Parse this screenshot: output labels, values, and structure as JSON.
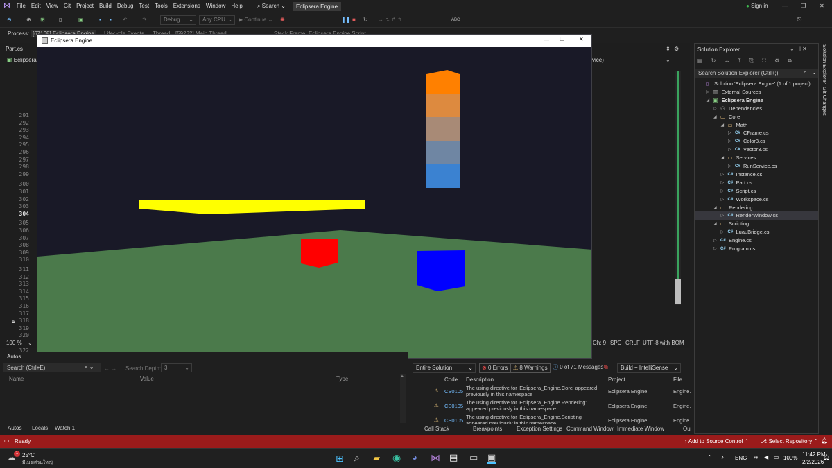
{
  "menubar": {
    "items": [
      "File",
      "Edit",
      "View",
      "Git",
      "Project",
      "Build",
      "Debug",
      "Test",
      "Tools",
      "Extensions",
      "Window",
      "Help"
    ],
    "search_label": "Search",
    "solution_title": "Eclipsera Engine",
    "sign_in": "Sign in"
  },
  "toolbar": {
    "config": "Debug",
    "platform": "Any CPU",
    "continue_label": "Continue"
  },
  "debugbar": {
    "process_label": "Process:",
    "process_value": "[67168] Eclipsera.Engine",
    "lifecycle": "Lifecycle Events",
    "thread_label": "Thread:",
    "thread_value": "[59232] Main Thread",
    "stack_frame": "Stack Frame:",
    "stack_value": "Eclipsera.Engine.Script"
  },
  "editor": {
    "file_tab": "Part.cs",
    "project_dropdown": "Eclipsera",
    "member_dropdown": "vice)",
    "line_numbers": [
      "291",
      "292",
      "293",
      "294",
      "295",
      "296",
      "297",
      "298",
      "299",
      "300",
      "301",
      "302",
      "303",
      "304",
      "305",
      "306",
      "307",
      "308",
      "309",
      "310",
      "311",
      "312",
      "313",
      "314",
      "315",
      "316",
      "317",
      "318",
      "319",
      "320",
      "321",
      "322"
    ],
    "zoom": "100 %",
    "ch": "Ch: 9",
    "spc": "SPC",
    "crlf": "CRLF",
    "encoding": "UTF-8 with BOM"
  },
  "render_window": {
    "title": "Eclipsera Engine",
    "colors": {
      "background": "#191927",
      "ground": "#4b7a4b",
      "beam": "#ffff00",
      "red_cube": "#ff0000",
      "blue_cube": "#0000ff",
      "stack": [
        "#ff8000",
        "#dd8a3f",
        "#a88a76",
        "#6f86a3",
        "#3b82d1"
      ]
    }
  },
  "solution_explorer": {
    "title": "Solution Explorer",
    "search_placeholder": "Search Solution Explorer (Ctrl+;)",
    "side_tabs": [
      "Solution Explorer",
      "Git Changes"
    ],
    "tree": [
      {
        "label": "Solution 'Eclipsera Engine' (1 of 1 project)",
        "depth": 0,
        "kind": "solution"
      },
      {
        "label": "External Sources",
        "depth": 1,
        "kind": "ext"
      },
      {
        "label": "Eclipsera Engine",
        "depth": 1,
        "kind": "project"
      },
      {
        "label": "Dependencies",
        "depth": 2,
        "kind": "deps"
      },
      {
        "label": "Core",
        "depth": 2,
        "kind": "folder"
      },
      {
        "label": "Math",
        "depth": 3,
        "kind": "folder"
      },
      {
        "label": "CFrame.cs",
        "depth": 4,
        "kind": "cs"
      },
      {
        "label": "Color3.cs",
        "depth": 4,
        "kind": "cs"
      },
      {
        "label": "Vector3.cs",
        "depth": 4,
        "kind": "cs"
      },
      {
        "label": "Services",
        "depth": 3,
        "kind": "folder"
      },
      {
        "label": "RunService.cs",
        "depth": 4,
        "kind": "cs"
      },
      {
        "label": "Instance.cs",
        "depth": 3,
        "kind": "cs"
      },
      {
        "label": "Part.cs",
        "depth": 3,
        "kind": "cs"
      },
      {
        "label": "Script.cs",
        "depth": 3,
        "kind": "cs"
      },
      {
        "label": "Workspace.cs",
        "depth": 3,
        "kind": "cs"
      },
      {
        "label": "Rendering",
        "depth": 2,
        "kind": "folder"
      },
      {
        "label": "RenderWindow.cs",
        "depth": 3,
        "kind": "cs",
        "selected": true
      },
      {
        "label": "Scripting",
        "depth": 2,
        "kind": "folder"
      },
      {
        "label": "LuauBridge.cs",
        "depth": 3,
        "kind": "cs"
      },
      {
        "label": "Engine.cs",
        "depth": 2,
        "kind": "cs"
      },
      {
        "label": "Program.cs",
        "depth": 2,
        "kind": "cs"
      }
    ]
  },
  "autos": {
    "title": "Autos",
    "search_placeholder": "Search (Ctrl+E)",
    "search_depth_label": "Search Depth:",
    "search_depth_value": "3",
    "columns": [
      "Name",
      "Value",
      "Type"
    ],
    "tabs": [
      "Autos",
      "Locals",
      "Watch 1"
    ]
  },
  "error_list": {
    "scope": "Entire Solution",
    "errors": "0 Errors",
    "warnings": "8 Warnings",
    "messages": "0 of 71 Messages",
    "build_filter": "Build + IntelliSense",
    "columns": [
      "Code",
      "Description",
      "Project",
      "File"
    ],
    "rows": [
      {
        "code": "CS0105",
        "description": "The using directive for 'Eclipsera_Engine.Core' appeared previously in this namespace",
        "project": "Eclipsera Engine",
        "file": "Engine."
      },
      {
        "code": "CS0105",
        "description": "The using directive for 'Eclipsera_Engine.Rendering' appeared previously in this namespace",
        "project": "Eclipsera Engine",
        "file": "Engine."
      },
      {
        "code": "CS0105",
        "description": "The using directive for 'Eclipsera_Engine.Scripting' appeared previously in this namespace",
        "project": "Eclipsera Engine",
        "file": "Engine."
      }
    ],
    "tabs": [
      "Call Stack",
      "Breakpoints",
      "Exception Settings",
      "Command Window",
      "Immediate Window",
      "Ou"
    ]
  },
  "status": {
    "text": "Ready",
    "add_source": "Add to Source Control",
    "select_repo": "Select Repository"
  },
  "taskbar": {
    "temp": "25°C",
    "weather": "มีเมฆส่วนใหญ่",
    "lang": "ENG",
    "battery": "100%",
    "time": "11:42 PM",
    "date": "2/2/2026",
    "weather_badge": "1"
  }
}
